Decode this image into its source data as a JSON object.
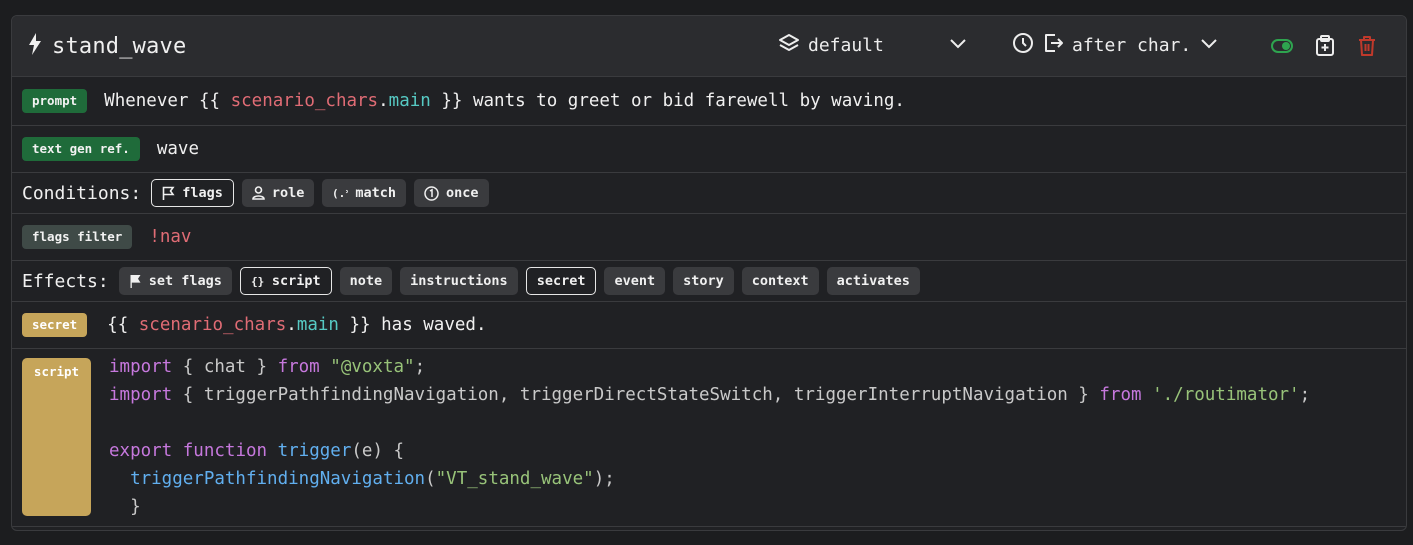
{
  "header": {
    "title": "stand_wave",
    "layer_label": "default",
    "timing_label": "after char."
  },
  "prompt_row": {
    "tag": "prompt",
    "text_before": "Whenever {{ ",
    "var_obj": "scenario_chars",
    "var_dot": ".",
    "var_prop": "main",
    "text_after": " }} wants to greet or bid farewell by waving."
  },
  "text_gen_row": {
    "tag": "text gen ref.",
    "value": "wave"
  },
  "conditions": {
    "label": "Conditions:",
    "chips": [
      {
        "label": "flags",
        "icon": "flag-icon",
        "active": true
      },
      {
        "label": "role",
        "icon": "user-icon",
        "active": false
      },
      {
        "label": "match",
        "icon": "regex-icon",
        "active": false
      },
      {
        "label": "once",
        "icon": "one-circle-icon",
        "active": false
      }
    ]
  },
  "flags_filter_row": {
    "tag": "flags filter",
    "value": "!nav"
  },
  "effects": {
    "label": "Effects:",
    "chips": [
      {
        "label": "set flags",
        "icon": "flag-filled-icon",
        "active": false
      },
      {
        "label": "script",
        "icon": "braces-icon",
        "active": true
      },
      {
        "label": "note",
        "active": false
      },
      {
        "label": "instructions",
        "active": false
      },
      {
        "label": "secret",
        "active": true
      },
      {
        "label": "event",
        "active": false
      },
      {
        "label": "story",
        "active": false
      },
      {
        "label": "context",
        "active": false
      },
      {
        "label": "activates",
        "active": false
      }
    ]
  },
  "secret_row": {
    "tag": "secret",
    "text_before": "{{ ",
    "var_obj": "scenario_chars",
    "var_dot": ".",
    "var_prop": "main",
    "text_after": " }} has waved."
  },
  "script_row": {
    "tag": "script",
    "code": {
      "l1_import": "import",
      "l1_mid": " { chat } ",
      "l1_from": "from",
      "l1_sp": " ",
      "l1_str": "\"@voxta\"",
      "l1_end": ";",
      "l2_import": "import",
      "l2_mid": " { triggerPathfindingNavigation, triggerDirectStateSwitch, triggerInterruptNavigation } ",
      "l2_from": "from",
      "l2_sp": " ",
      "l2_str": "'./routimator'",
      "l2_end": ";",
      "l4_export": "export",
      "l4_function": "function",
      "l4_name": "trigger",
      "l4_args": "(e) {",
      "l5_indent": "  ",
      "l5_call": "triggerPathfindingNavigation",
      "l5_open": "(",
      "l5_str": "\"VT_stand_wave\"",
      "l5_close": ");",
      "l6": "  }"
    }
  },
  "colors": {
    "green_tag": "#1f6b3a",
    "gold_tag": "#c6a55a",
    "toggle_on": "#2ea44f",
    "delete_red": "#c0392b"
  }
}
